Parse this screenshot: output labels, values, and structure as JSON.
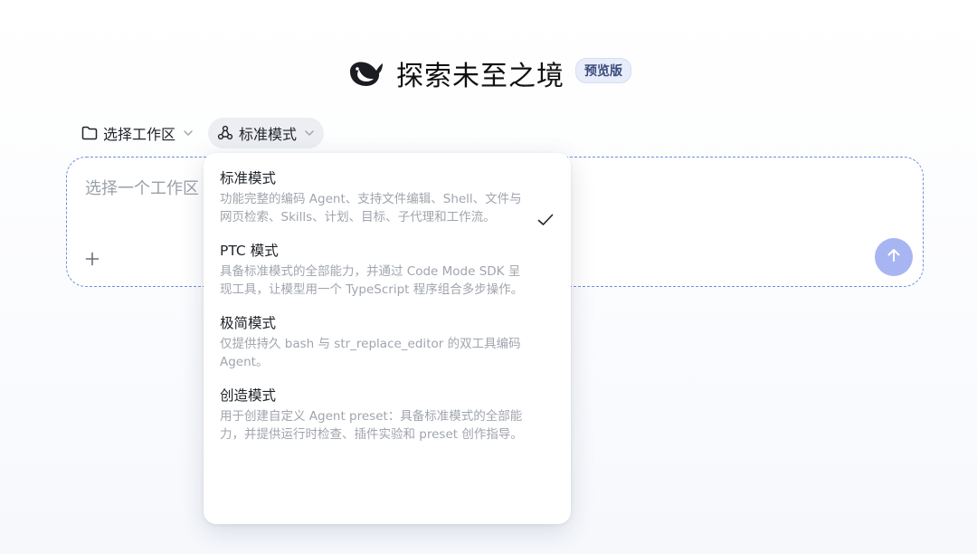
{
  "header": {
    "logo_icon": "whale-logo-icon",
    "title": "探索未至之境",
    "badge": "预览版"
  },
  "toolbar": {
    "workspace_label": "选择工作区",
    "mode_label": "标准模式"
  },
  "composer": {
    "placeholder": "选择一个工作区"
  },
  "dropdown": {
    "items": [
      {
        "title": "标准模式",
        "description": "功能完整的编码 Agent、支持文件编辑、Shell、文件与网页检索、Skills、计划、目标、子代理和工作流。",
        "selected": true
      },
      {
        "title": "PTC 模式",
        "description": "具备标准模式的全部能力，并通过 Code Mode SDK 呈现工具，让模型用一个 TypeScript 程序组合多步操作。",
        "selected": false
      },
      {
        "title": "极简模式",
        "description": "仅提供持久 bash 与 str_replace_editor 的双工具编码 Agent。",
        "selected": false
      },
      {
        "title": "创造模式",
        "description": "用于创建自定义 Agent preset：具备标准模式的全部能力，并提供运行时检查、插件实验和 preset 创作指导。",
        "selected": false
      }
    ]
  },
  "colors": {
    "accent": "#6e8fdf",
    "send_button": "#a7b6f2",
    "badge_bg": "#e8edfb",
    "logo": "#1a1c22"
  }
}
